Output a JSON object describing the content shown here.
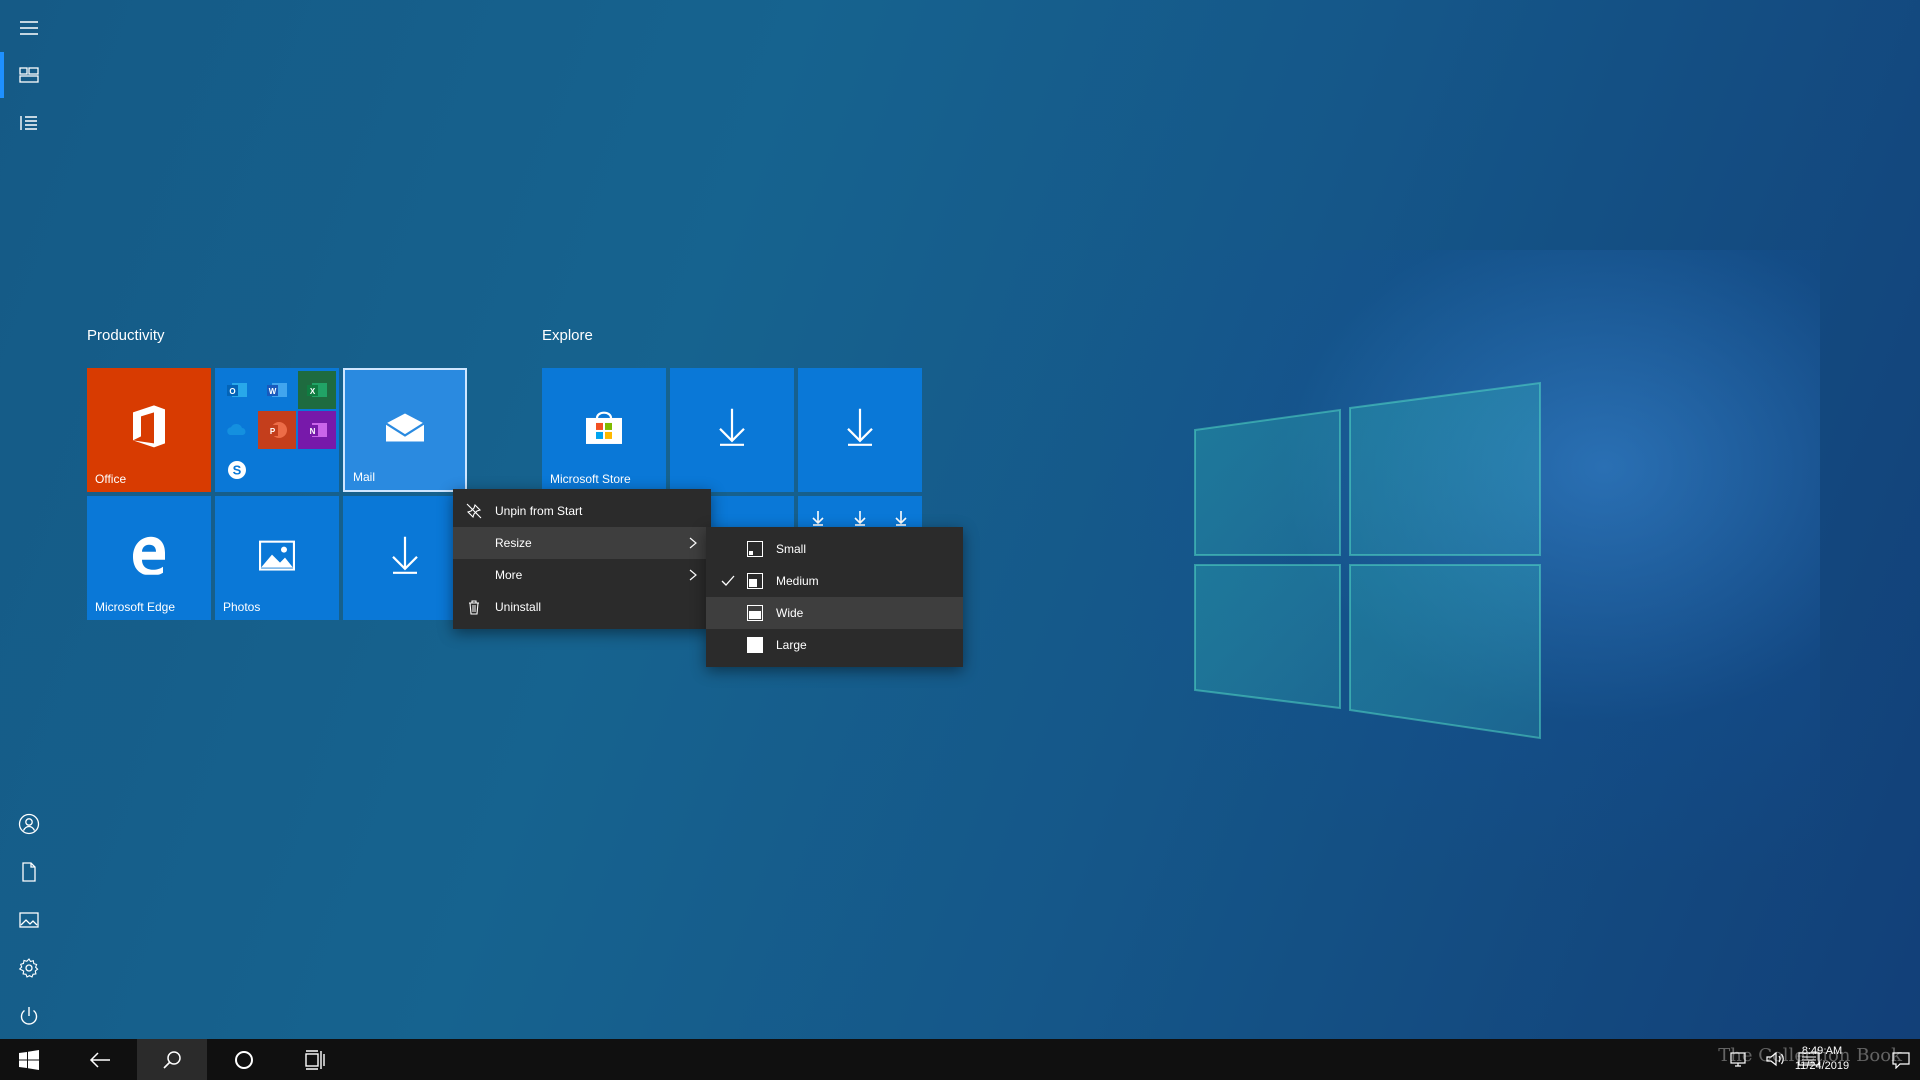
{
  "groups": {
    "productivity": {
      "title": "Productivity"
    },
    "explore": {
      "title": "Explore"
    }
  },
  "tiles": {
    "office": {
      "label": "Office",
      "color": "#d83b01"
    },
    "mail": {
      "label": "Mail"
    },
    "edge": {
      "label": "Microsoft Edge"
    },
    "photos": {
      "label": "Photos"
    },
    "store": {
      "label": "Microsoft Store"
    }
  },
  "context_menu": {
    "items": [
      {
        "label": "Unpin from Start",
        "icon": "unpin-icon"
      },
      {
        "label": "Resize",
        "submenu": true
      },
      {
        "label": "More",
        "submenu": true
      },
      {
        "label": "Uninstall",
        "icon": "trash-icon"
      }
    ]
  },
  "resize_menu": {
    "items": [
      {
        "label": "Small",
        "checked": false
      },
      {
        "label": "Medium",
        "checked": true
      },
      {
        "label": "Wide",
        "checked": false,
        "highlighted": true
      },
      {
        "label": "Large",
        "checked": false
      }
    ]
  },
  "taskbar": {
    "clock_time": "8:49 AM",
    "clock_date": "11/24/2019",
    "watermark": "The Collection Book"
  },
  "colors": {
    "tile_blue": "#0a78d7",
    "office_orange": "#d83b01",
    "menu_bg": "#2b2b2b",
    "taskbar_bg": "#101010"
  }
}
